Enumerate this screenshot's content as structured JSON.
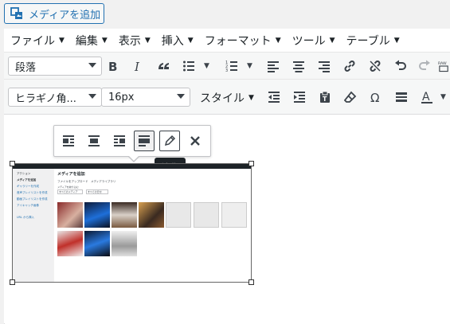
{
  "media_button": {
    "label": "メディアを追加",
    "icon": "media-icon"
  },
  "menubar": [
    {
      "label": "ファイル"
    },
    {
      "label": "編集"
    },
    {
      "label": "表示"
    },
    {
      "label": "挿入"
    },
    {
      "label": "フォーマット"
    },
    {
      "label": "ツール"
    },
    {
      "label": "テーブル"
    }
  ],
  "toolbar1": {
    "format_select": "段落",
    "buttons": [
      "bold-icon",
      "italic-icon",
      "blockquote-icon",
      "bullet-list-icon",
      "numbered-list-icon",
      "align-left-icon",
      "align-center-icon",
      "align-right-icon",
      "link-icon",
      "unlink-icon",
      "undo-icon",
      "redo-icon",
      "paste-raw-icon"
    ]
  },
  "toolbar2": {
    "font_family": "ヒラギノ角...",
    "font_size": "16px",
    "style_label": "スタイル",
    "buttons": [
      "outdent-icon",
      "indent-icon",
      "paste-text-icon",
      "clear-formatting-icon",
      "special-char-icon",
      "horizontal-line-icon",
      "text-color-icon"
    ]
  },
  "image_toolbar": {
    "buttons": [
      "align-left-icon",
      "align-center-icon",
      "align-right-icon",
      "align-none-icon",
      "edit-pencil-icon",
      "remove-icon"
    ],
    "tooltip": "編集"
  },
  "embedded_screenshot": {
    "title": "メディアを追加",
    "tab1": "ファイルをアップロード",
    "tab2": "メディアライブラリ",
    "filter_label": "メディアを絞り込む",
    "filter1": "すべてのメディア",
    "filter2": "すべての日付",
    "sidebar_links": [
      "メディアを追加",
      "ギャラリーを作成",
      "音声プレイリストを作成",
      "動画プレイリストを作成",
      "アイキャッチ画像"
    ],
    "sidebar_header": "アクション",
    "sidebar_link_last": "URL から挿入"
  },
  "colors": {
    "accent": "#2271b1",
    "dark": "#1d2327"
  }
}
